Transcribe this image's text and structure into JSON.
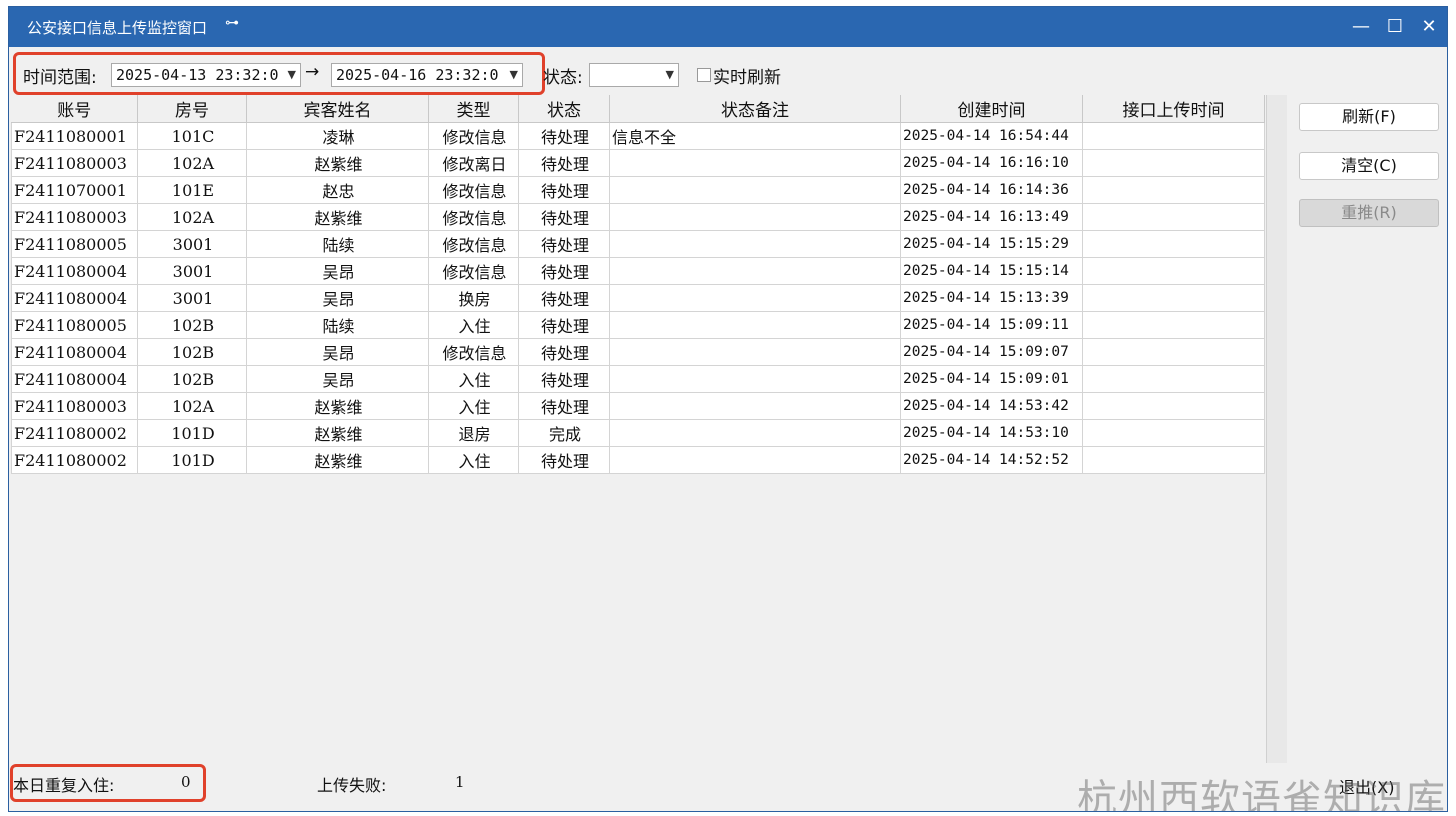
{
  "window": {
    "title": "公安接口信息上传监控窗口",
    "controls": {
      "minimize": "—",
      "maximize": "☐",
      "close": "✕"
    }
  },
  "filters": {
    "time_range_label": "时间范围:",
    "start_time": "2025-04-13 23:32:0",
    "arrow": "→",
    "end_time": "2025-04-16 23:32:0",
    "status_label": "状态:",
    "status_value": "",
    "realtime_refresh_label": "实时刷新",
    "realtime_refresh_checked": false
  },
  "table": {
    "columns": [
      "账号",
      "房号",
      "宾客姓名",
      "类型",
      "状态",
      "状态备注",
      "创建时间",
      "接口上传时间"
    ],
    "rows": [
      [
        "F2411080001",
        "101C",
        "凌琳",
        "修改信息",
        "待处理",
        "信息不全",
        "2025-04-14 16:54:44",
        ""
      ],
      [
        "F2411080003",
        "102A",
        "赵紫维",
        "修改离日",
        "待处理",
        "",
        "2025-04-14 16:16:10",
        ""
      ],
      [
        "F2411070001",
        "101E",
        "赵忠",
        "修改信息",
        "待处理",
        "",
        "2025-04-14 16:14:36",
        ""
      ],
      [
        "F2411080003",
        "102A",
        "赵紫维",
        "修改信息",
        "待处理",
        "",
        "2025-04-14 16:13:49",
        ""
      ],
      [
        "F2411080005",
        "3001",
        "陆续",
        "修改信息",
        "待处理",
        "",
        "2025-04-14 15:15:29",
        ""
      ],
      [
        "F2411080004",
        "3001",
        "吴昂",
        "修改信息",
        "待处理",
        "",
        "2025-04-14 15:15:14",
        ""
      ],
      [
        "F2411080004",
        "3001",
        "吴昂",
        "换房",
        "待处理",
        "",
        "2025-04-14 15:13:39",
        ""
      ],
      [
        "F2411080005",
        "102B",
        "陆续",
        "入住",
        "待处理",
        "",
        "2025-04-14 15:09:11",
        ""
      ],
      [
        "F2411080004",
        "102B",
        "吴昂",
        "修改信息",
        "待处理",
        "",
        "2025-04-14 15:09:07",
        ""
      ],
      [
        "F2411080004",
        "102B",
        "吴昂",
        "入住",
        "待处理",
        "",
        "2025-04-14 15:09:01",
        ""
      ],
      [
        "F2411080003",
        "102A",
        "赵紫维",
        "入住",
        "待处理",
        "",
        "2025-04-14 14:53:42",
        ""
      ],
      [
        "F2411080002",
        "101D",
        "赵紫维",
        "退房",
        "完成",
        "",
        "2025-04-14 14:53:10",
        ""
      ],
      [
        "F2411080002",
        "101D",
        "赵紫维",
        "入住",
        "待处理",
        "",
        "2025-04-14 14:52:52",
        ""
      ]
    ]
  },
  "buttons": {
    "refresh": "刷新(F)",
    "clear": "清空(C)",
    "repush": "重推(R)",
    "exit": "退出(X)"
  },
  "status": {
    "duplicate_checkin_label": "本日重复入住:",
    "duplicate_checkin_value": "0",
    "upload_fail_label": "上传失败:",
    "upload_fail_value": "1"
  },
  "watermark": "杭州西软语雀知识库",
  "colors": {
    "titlebar": "#2a67b1",
    "highlight": "#e0412b"
  }
}
